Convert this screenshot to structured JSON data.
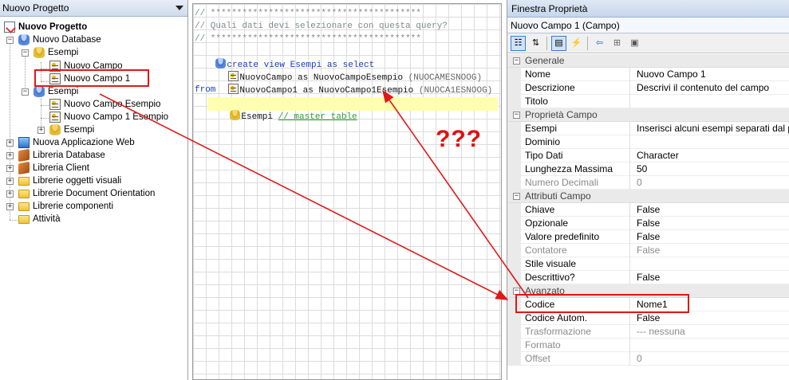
{
  "left_panel": {
    "title": "Nuovo Progetto",
    "tree": [
      {
        "label": "Nuovo Progetto",
        "bold": true
      },
      {
        "label": "Nuovo Database"
      },
      {
        "label": "Esempi"
      },
      {
        "label": "Nuovo Campo"
      },
      {
        "label": "Nuovo Campo 1"
      },
      {
        "label": "Esempi"
      },
      {
        "label": "Nuovo Campo Esempio"
      },
      {
        "label": "Nuovo Campo 1 Esempio"
      },
      {
        "label": "Esempi"
      },
      {
        "label": "Nuova Applicazione Web"
      },
      {
        "label": "Libreria Database"
      },
      {
        "label": "Libreria Client"
      },
      {
        "label": "Librerie oggetti visuali"
      },
      {
        "label": "Librerie Document Orientation"
      },
      {
        "label": "Librerie componenti"
      },
      {
        "label": "Attività"
      }
    ]
  },
  "code": {
    "line1": "// ****************************************",
    "line2": "// Quali dati devi selezionare con questa query?",
    "line3": "// ****************************************",
    "line4": "create view Esempi as select",
    "line5_field": "NuovoCampo as NuovoCampoEsempio",
    "line5_hint": "(NUOCAMESNOOG)",
    "line6_field": "NuovoCampo1 as NuovoCampo1Esempio",
    "line6_hint": "(NUOCA1ESNOOG)",
    "line7": "from",
    "line8_table": "Esempi",
    "line8_comment": "// master table"
  },
  "annotation": {
    "question": "???",
    "color": "#e01818"
  },
  "properties": {
    "title": "Finestra Proprietà",
    "object": "Nuovo Campo 1 (Campo)",
    "toolbar": [
      "categorized-icon",
      "alphabetical-icon",
      "properties-icon",
      "events-icon",
      "back-icon",
      "tree-icon",
      "save-icon"
    ],
    "categories": [
      {
        "name": "Generale",
        "props": [
          {
            "name": "Nome",
            "value": "Nuovo Campo 1"
          },
          {
            "name": "Descrizione",
            "value": "Descrivi il contenuto del campo"
          },
          {
            "name": "Titolo",
            "value": ""
          }
        ]
      },
      {
        "name": "Proprietà Campo",
        "props": [
          {
            "name": "Esempi",
            "value": "Inserisci alcuni esempi separati dal pu"
          },
          {
            "name": "Dominio",
            "value": ""
          },
          {
            "name": "Tipo Dati",
            "value": "Character"
          },
          {
            "name": "Lunghezza Massima",
            "value": "50"
          },
          {
            "name": "Numero Decimali",
            "value": "0",
            "disabled": true
          }
        ]
      },
      {
        "name": "Attributi Campo",
        "props": [
          {
            "name": "Chiave",
            "value": "False"
          },
          {
            "name": "Opzionale",
            "value": "False"
          },
          {
            "name": "Valore predefinito",
            "value": "False"
          },
          {
            "name": "Contatore",
            "value": "False",
            "disabled": true
          },
          {
            "name": "Stile visuale",
            "value": ""
          },
          {
            "name": "Descrittivo?",
            "value": "False"
          }
        ]
      },
      {
        "name": "Avanzato",
        "props": [
          {
            "name": "Codice",
            "value": "Nome1"
          },
          {
            "name": "Codice Autom.",
            "value": "False"
          },
          {
            "name": "Trasformazione",
            "value": "--- nessuna",
            "disabled": true
          },
          {
            "name": "Formato",
            "value": "",
            "disabled": true
          },
          {
            "name": "Offset",
            "value": "0",
            "disabled": true
          }
        ]
      }
    ]
  }
}
